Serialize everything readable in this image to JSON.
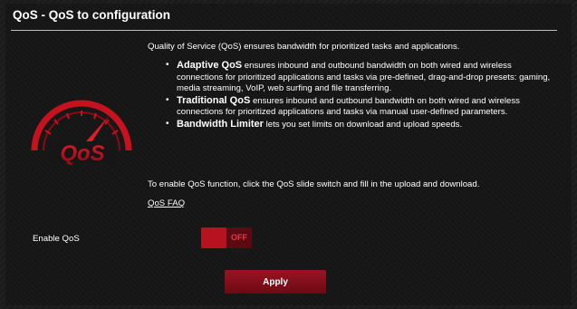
{
  "page": {
    "title": "QoS - QoS to configuration"
  },
  "logo": {
    "icon": "qos-speedometer-icon",
    "text": "QoS"
  },
  "content": {
    "intro": "Quality of Service (QoS) ensures bandwidth for prioritized tasks and applications.",
    "features": [
      {
        "name": "Adaptive QoS",
        "description": " ensures inbound and outbound bandwidth on both wired and wireless connections for prioritized applications and tasks via pre-defined, drag-and-drop presets: gaming, media streaming, VoIP, web surfing and file transferring."
      },
      {
        "name": "Traditional QoS",
        "description": " ensures inbound and outbound bandwidth on both wired and wireless connections for prioritized applications and tasks via manual user-defined parameters."
      },
      {
        "name": "Bandwidth Limiter",
        "description": " lets you set limits on download and upload speeds."
      }
    ],
    "enable_instructions": "To enable QoS function, click the QoS slide switch and fill in the upload and download.",
    "faq_link": "QoS FAQ"
  },
  "settings": {
    "enable_qos_label": "Enable QoS",
    "toggle_state": "OFF"
  },
  "actions": {
    "apply_label": "Apply"
  },
  "colors": {
    "accent": "#b5131f",
    "background": "#161616",
    "text": "#ffffff"
  }
}
